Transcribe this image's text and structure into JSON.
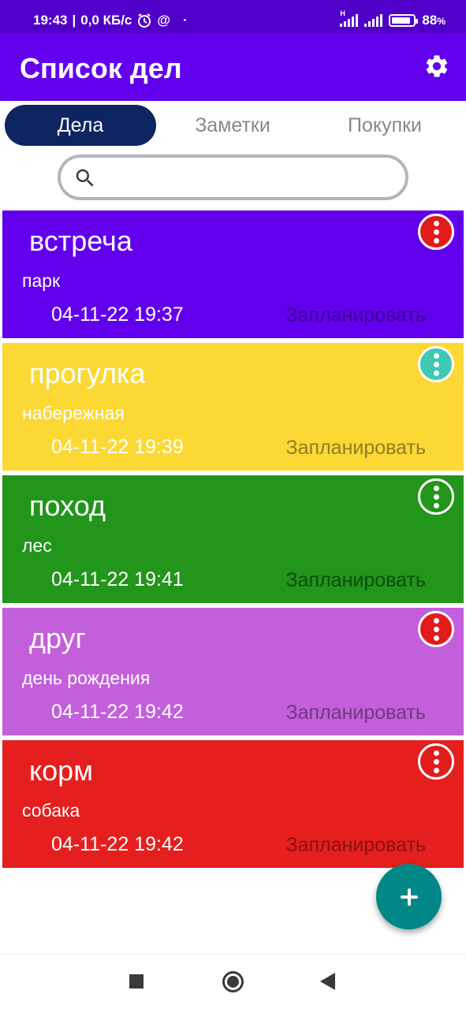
{
  "status_bar": {
    "time": "19:43",
    "speed": "0,0 КБ/с",
    "network_label": "H",
    "battery": "88",
    "battery_unit": "%",
    "battery_level": 0.88
  },
  "app_bar": {
    "title": "Список дел",
    "settings_icon": "gear-icon"
  },
  "tabs": [
    {
      "label": "Дела",
      "active": true
    },
    {
      "label": "Заметки",
      "active": false
    },
    {
      "label": "Покупки",
      "active": false
    }
  ],
  "search": {
    "placeholder": "",
    "value": ""
  },
  "tasks": [
    {
      "title": "встреча",
      "description": "парк",
      "datetime": "04-11-22 19:37",
      "action": "Запланировать",
      "color": "#6200ee",
      "action_color": "#3c0392",
      "menu_color": "#e31b1b"
    },
    {
      "title": "прогулка",
      "description": "набережная",
      "datetime": "04-11-22 19:39",
      "action": "Запланировать",
      "color": "#fcd834",
      "action_color": "#8f7d25",
      "menu_color": "#3fc9b2"
    },
    {
      "title": "поход",
      "description": "лес",
      "datetime": "04-11-22 19:41",
      "action": "Запланировать",
      "color": "#22951b",
      "action_color": "#0d4d0c",
      "menu_color": "#22951b"
    },
    {
      "title": "друг",
      "description": "день рождения",
      "datetime": "04-11-22 19:42",
      "action": "Запланировать",
      "color": "#c35fdb",
      "action_color": "#6e3a80",
      "menu_color": "#e31b1b"
    },
    {
      "title": "корм",
      "description": "собака",
      "datetime": "04-11-22 19:42",
      "action": "Запланировать",
      "color": "#e51e1e",
      "action_color": "#8a1313",
      "menu_color": "#e31b1b"
    }
  ],
  "fab": {
    "icon": "plus-icon",
    "color": "#018786"
  },
  "nav": {
    "recents_icon": "square-icon",
    "home_icon": "circle-icon",
    "back_icon": "triangle-back-icon"
  }
}
